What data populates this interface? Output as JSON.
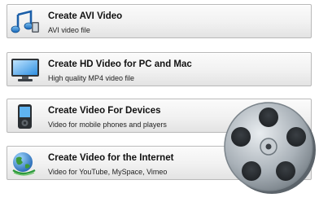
{
  "options": [
    {
      "title": "Create AVI Video",
      "subtitle": "AVI video file",
      "icon": "music-notes-icon"
    },
    {
      "title": "Create HD Video for PC and Mac",
      "subtitle": "High quality MP4 video file",
      "icon": "monitor-icon"
    },
    {
      "title": "Create Video For Devices",
      "subtitle": "Video for mobile phones and players",
      "icon": "media-player-icon"
    },
    {
      "title": "Create Video for the Internet",
      "subtitle": "Video for YouTube, MySpace, Vimeo",
      "icon": "globe-icon"
    }
  ],
  "decoration": {
    "icon": "film-reel-icon"
  },
  "colors": {
    "accent": "#1a73c9",
    "reel": "#9aa3aa"
  }
}
